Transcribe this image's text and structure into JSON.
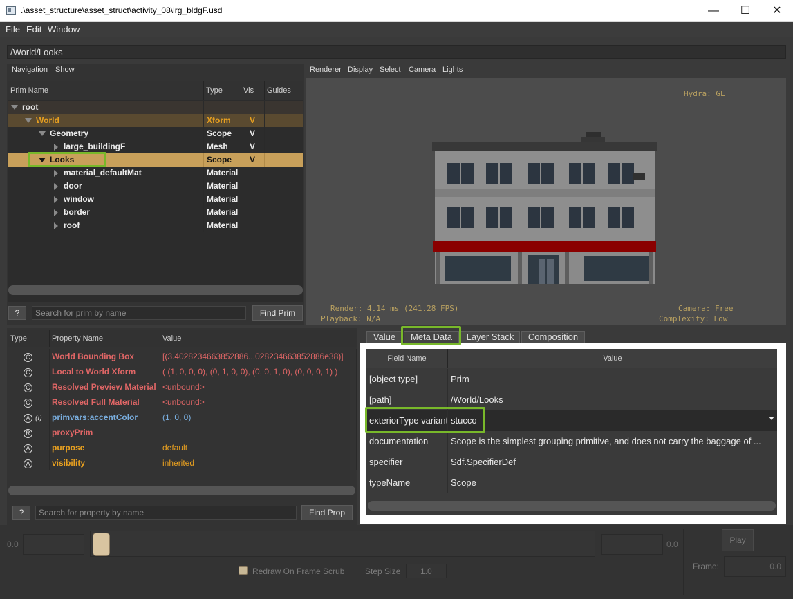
{
  "window": {
    "title": ".\\asset_structure\\asset_struct\\activity_08\\lrg_bldgF.usd",
    "minimize_icon": "minimize-icon",
    "maximize_icon": "maximize-icon",
    "close_icon": "close-icon"
  },
  "menu": {
    "items": [
      "File",
      "Edit",
      "Window"
    ]
  },
  "path": "/World/Looks",
  "prim_panel": {
    "subbar": [
      "Navigation",
      "Show"
    ],
    "headers": [
      "Prim Name",
      "Type",
      "Vis",
      "Guides"
    ],
    "rows": [
      {
        "name": "root",
        "type": "",
        "vis": "",
        "expanded": true
      },
      {
        "name": "World",
        "type": "Xform",
        "vis": "V",
        "expanded": true
      },
      {
        "name": "Geometry",
        "type": "Scope",
        "vis": "V",
        "expanded": true
      },
      {
        "name": "large_buildingF",
        "type": "Mesh",
        "vis": "V",
        "expanded": false
      },
      {
        "name": "Looks",
        "type": "Scope",
        "vis": "V",
        "expanded": true
      },
      {
        "name": "material_defaultMat",
        "type": "Material",
        "vis": "",
        "expanded": false
      },
      {
        "name": "door",
        "type": "Material",
        "vis": "",
        "expanded": false
      },
      {
        "name": "window",
        "type": "Material",
        "vis": "",
        "expanded": false
      },
      {
        "name": "border",
        "type": "Material",
        "vis": "",
        "expanded": false
      },
      {
        "name": "roof",
        "type": "Material",
        "vis": "",
        "expanded": false
      }
    ],
    "help_label": "?",
    "search_placeholder": "Search for prim by name",
    "find_label": "Find Prim"
  },
  "viewport": {
    "menu": [
      "Renderer",
      "Display",
      "Select",
      "Camera",
      "Lights"
    ],
    "hydra": "Hydra: GL",
    "render": "Render: 4.14 ms (241.28 FPS)",
    "playback": "Playback: N/A",
    "camera": "Camera: Free",
    "complexity": "Complexity: Low"
  },
  "prop_panel": {
    "headers": [
      "Type",
      "Property Name",
      "Value"
    ],
    "rows": [
      {
        "icon": "C",
        "flag": "",
        "name": "World Bounding Box",
        "value": "[(3.4028234663852886...028234663852886e38)]",
        "color": "#e06666"
      },
      {
        "icon": "C",
        "flag": "",
        "name": "Local to World Xform",
        "value": "( (1, 0, 0, 0), (0, 1, 0, 0), (0, 0, 1, 0), (0, 0, 0, 1) )",
        "color": "#e06666"
      },
      {
        "icon": "C",
        "flag": "",
        "name": "Resolved Preview Material",
        "value": "<unbound>",
        "color": "#e06666"
      },
      {
        "icon": "C",
        "flag": "",
        "name": "Resolved Full Material",
        "value": "<unbound>",
        "color": "#e06666"
      },
      {
        "icon": "A",
        "flag": "(i)",
        "name": "primvars:accentColor",
        "value": "(1, 0, 0)",
        "color": "#7aafe0"
      },
      {
        "icon": "R",
        "flag": "",
        "name": "proxyPrim",
        "value": "",
        "color": "#e06666"
      },
      {
        "icon": "A",
        "flag": "",
        "name": "purpose",
        "value": "default",
        "color": "#e8a020"
      },
      {
        "icon": "A",
        "flag": "",
        "name": "visibility",
        "value": "inherited",
        "color": "#e8a020"
      }
    ],
    "help_label": "?",
    "search_placeholder": "Search for property by name",
    "find_label": "Find Prop"
  },
  "meta_panel": {
    "tabs": [
      "Value",
      "Meta Data",
      "Layer Stack",
      "Composition"
    ],
    "headers": [
      "Field Name",
      "Value"
    ],
    "rows": [
      {
        "field": "[object type]",
        "value": "Prim"
      },
      {
        "field": "[path]",
        "value": "/World/Looks"
      },
      {
        "field": "exteriorType variant",
        "value": "stucco"
      },
      {
        "field": "documentation",
        "value": "Scope is the simplest grouping primitive, and does not carry the baggage of ..."
      },
      {
        "field": "specifier",
        "value": "Sdf.SpecifierDef"
      },
      {
        "field": "typeName",
        "value": "Scope"
      }
    ]
  },
  "timeline": {
    "start": "0.0",
    "end": "0.0",
    "play_label": "Play",
    "frame_label": "Frame:",
    "frame_value": "0.0",
    "redraw_label": "Redraw On Frame Scrub",
    "step_label": "Step Size",
    "step_value": "1.0"
  },
  "colors": {
    "selected_row": "#c8a05a",
    "world_row": "#5a4a30",
    "highlight": "#78b82a",
    "awning": "#8a0000"
  }
}
